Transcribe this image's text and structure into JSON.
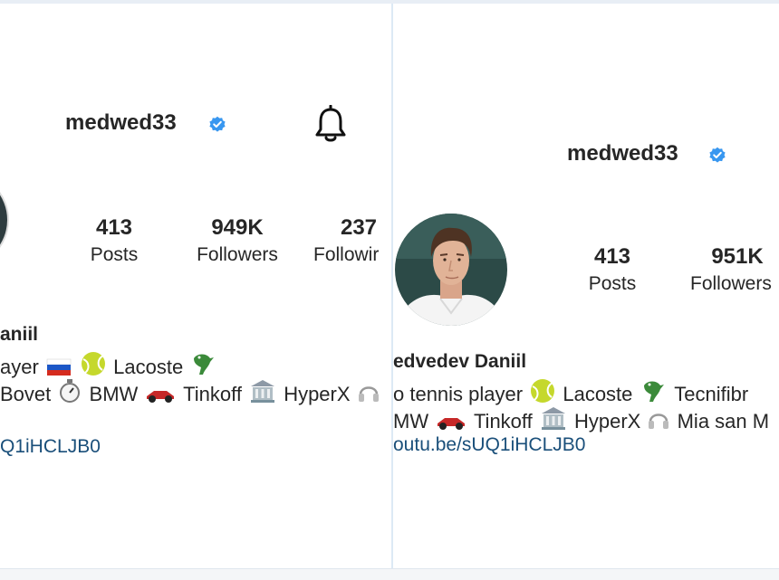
{
  "left": {
    "username": "medwed33",
    "posts_count": "413",
    "posts_label": "Posts",
    "followers_count": "949K",
    "followers_label": "Followers",
    "following_count": "237",
    "following_label": "Followir",
    "name_partial": "aniil",
    "bio_line1_a": "ayer",
    "bio_line1_b": "Lacoste",
    "bio_line2_a": "Bovet",
    "bio_line2_b": "BMW",
    "bio_line2_c": "Tinkoff",
    "bio_line2_d": "HyperX",
    "link": "Q1iHCLJB0"
  },
  "right": {
    "username": "medwed33",
    "posts_count": "413",
    "posts_label": "Posts",
    "followers_count": "951K",
    "followers_label": "Followers",
    "name": "edvedev Daniil",
    "bio_line1_a": "o tennis player",
    "bio_line1_b": "Lacoste",
    "bio_line1_c": "Tecnifibr",
    "bio_line2_a": "MW",
    "bio_line2_b": "Tinkoff",
    "bio_line2_c": "HyperX",
    "bio_line2_d": "Mia san M",
    "link": "outu.be/sUQ1iHCLJB0"
  },
  "icons": {
    "verified": "verified-badge-icon",
    "bell": "bell-icon",
    "flag": "russia-flag-icon",
    "tennis": "tennis-ball-icon",
    "crocodile": "crocodile-icon",
    "stopwatch": "stopwatch-icon",
    "race_car": "race-car-icon",
    "bank": "bank-icon",
    "headphones": "headphones-icon"
  },
  "colors": {
    "verified": "#3897f0",
    "link": "#1a4f7a",
    "divider": "#dce9f5"
  }
}
